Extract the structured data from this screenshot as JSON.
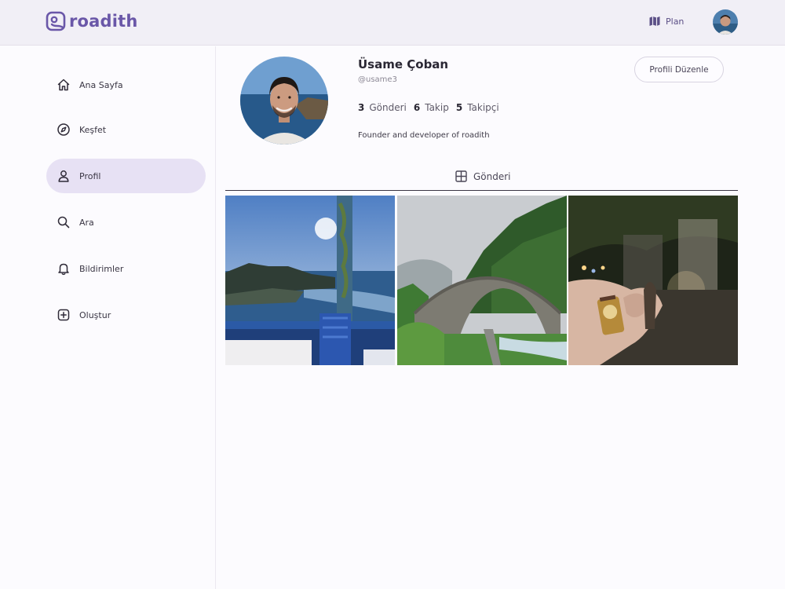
{
  "app": {
    "name": "roadith",
    "brand_color": "#6a57a8",
    "accent_bg": "#e7e1f4"
  },
  "header": {
    "plan_label": "Plan",
    "plan_icon": "map-icon"
  },
  "sidebar": {
    "items": [
      {
        "label": "Ana Sayfa",
        "icon": "home-icon",
        "active": false
      },
      {
        "label": "Keşfet",
        "icon": "compass-icon",
        "active": false
      },
      {
        "label": "Profil",
        "icon": "user-icon",
        "active": true
      },
      {
        "label": "Ara",
        "icon": "search-icon",
        "active": false
      },
      {
        "label": "Bildirimler",
        "icon": "bell-icon",
        "active": false
      },
      {
        "label": "Oluştur",
        "icon": "plus-square-icon",
        "active": false
      }
    ]
  },
  "profile": {
    "name": "Üsame Çoban",
    "handle": "@usame3",
    "edit_label": "Profili Düzenle",
    "stats": [
      {
        "value": "3",
        "label": "Gönderi"
      },
      {
        "value": "6",
        "label": "Takip"
      },
      {
        "value": "5",
        "label": "Takipçi"
      }
    ],
    "bio": "Founder and developer of roadith"
  },
  "tabs": {
    "posts_label": "Gönderi",
    "posts_icon": "grid-icon"
  },
  "posts": [
    {
      "subject": "sunset-sea-terrace"
    },
    {
      "subject": "stone-bridge-forest"
    },
    {
      "subject": "keychain-night"
    }
  ]
}
